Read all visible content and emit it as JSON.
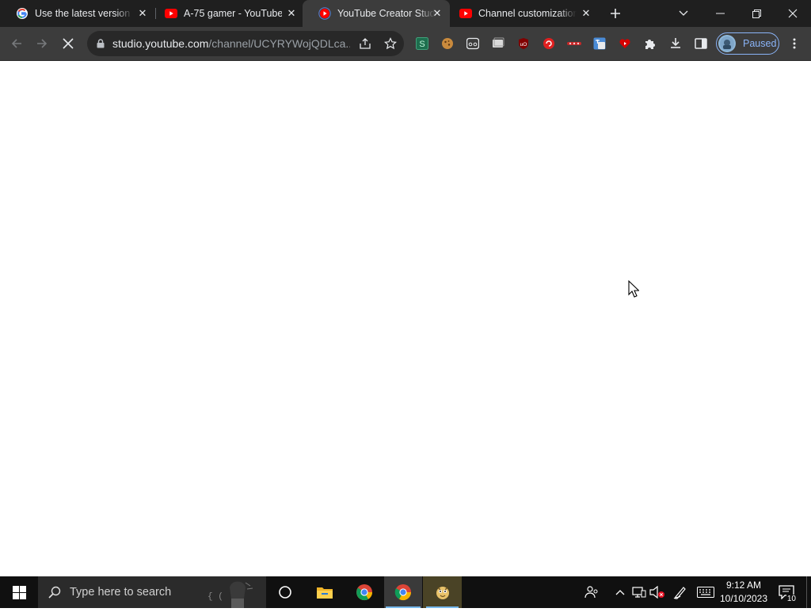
{
  "browser": {
    "tabs": [
      {
        "title": "Use the latest version o",
        "favicon": "google-icon",
        "active": false
      },
      {
        "title": "A-75 gamer - YouTube",
        "favicon": "youtube-icon",
        "active": false
      },
      {
        "title": "YouTube Creator Studio",
        "favicon": "youtube-studio-icon",
        "active": true
      },
      {
        "title": "Channel customization",
        "favicon": "youtube-icon",
        "active": false
      }
    ],
    "new_tab_icon": "plus-icon",
    "window_controls": [
      "tab-search-icon",
      "minimize-icon",
      "restore-icon",
      "close-icon"
    ],
    "toolbar": {
      "back_icon": "back-arrow-icon",
      "forward_icon": "forward-arrow-icon",
      "stop_icon": "stop-loading-icon",
      "url_host": "studio.youtube.com",
      "url_path": "/channel/UCYRYWojQDLca...",
      "omnibox_icons": [
        "share-icon",
        "bookmark-star-icon"
      ],
      "extensions": [
        "s-extension-icon",
        "cookie-icon",
        "extension-face-icon",
        "extension-screen-icon",
        "ublock-icon",
        "red-circle-icon",
        "red-dots-icon",
        "translate-icon",
        "red-heart-icon",
        "puzzle-icon",
        "download-icon",
        "side-panel-icon"
      ],
      "profile_label": "Paused",
      "menu_icon": "three-dot-menu-icon"
    }
  },
  "taskbar": {
    "search_placeholder": "Type here to search",
    "pinned": [
      "task-view-icon",
      "file-explorer-icon",
      "chrome-icon",
      "chrome-icon",
      "app-icon"
    ],
    "tray_icons": [
      "people-icon",
      "chevron-up-icon",
      "network-icon",
      "volume-muted-icon",
      "pen-icon",
      "keyboard-icon"
    ],
    "time": "9:12 AM",
    "date": "10/10/2023",
    "notification_count": "10"
  },
  "colors": {
    "tabstrip_bg": "#1f1f1f",
    "toolbar_bg": "#3c3c3c",
    "omnibox_bg": "#282828",
    "taskbar_bg": "#101010",
    "accent_blue": "#8ab4f8",
    "youtube_red": "#ff0000"
  }
}
